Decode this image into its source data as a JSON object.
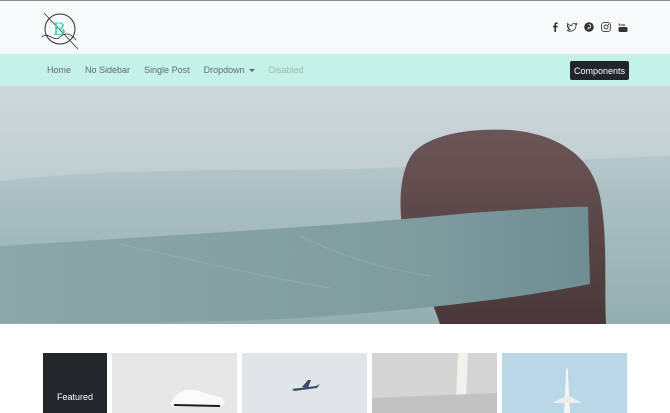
{
  "header": {
    "logo_icon": "b-monogram-logo",
    "social_icons": [
      "facebook-icon",
      "twitter-icon",
      "pinterest-icon",
      "instagram-icon",
      "youtube-icon"
    ]
  },
  "nav": {
    "items": [
      {
        "label": "Home"
      },
      {
        "label": "No Sidebar"
      },
      {
        "label": "Single Post"
      },
      {
        "label": "Dropdown"
      },
      {
        "label": "Disabled"
      }
    ],
    "button_label": "Components"
  },
  "featured": {
    "label": "Featured"
  },
  "colors": {
    "nav_bg": "#c4f2e6",
    "header_bg": "#f8f9fa",
    "accent": "#22262b",
    "logo_accent": "#3dd6b8"
  }
}
